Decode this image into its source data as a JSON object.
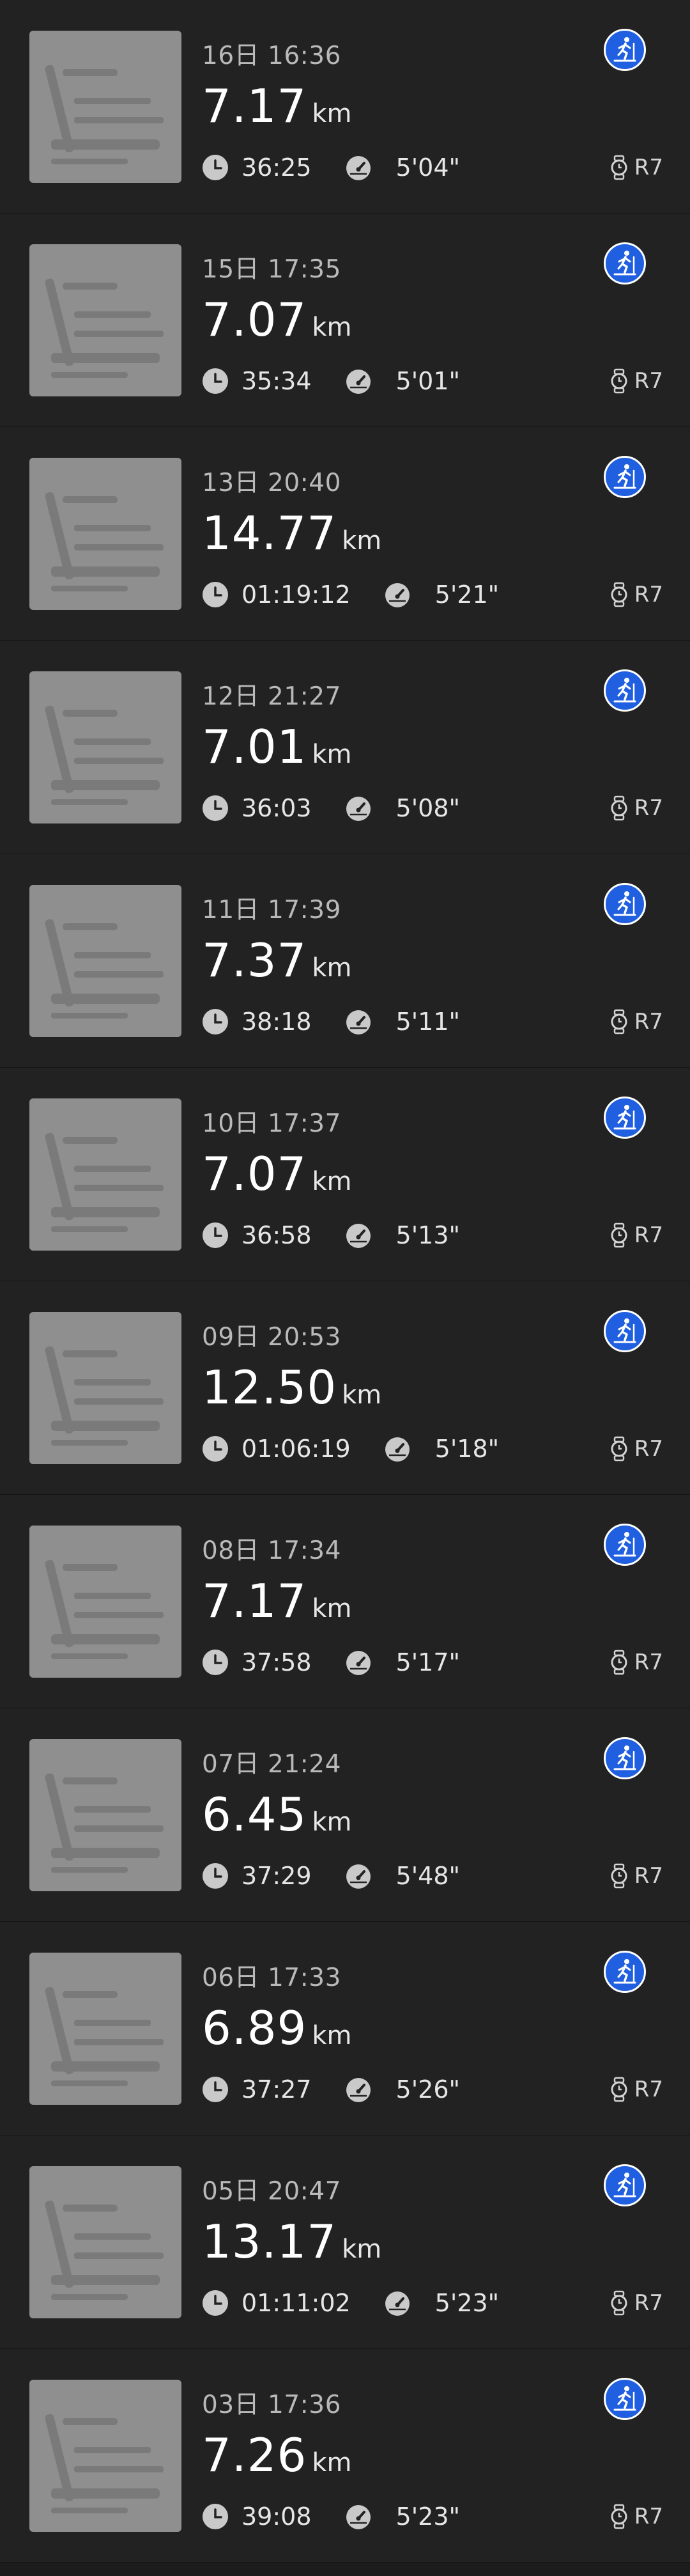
{
  "runs": [
    {
      "date": "16日 16:36",
      "distance": "7.17",
      "unit": "km",
      "duration": "36:25",
      "pace": "5'04\"",
      "device": "R7"
    },
    {
      "date": "15日 17:35",
      "distance": "7.07",
      "unit": "km",
      "duration": "35:34",
      "pace": "5'01\"",
      "device": "R7"
    },
    {
      "date": "13日 20:40",
      "distance": "14.77",
      "unit": "km",
      "duration": "01:19:12",
      "pace": "5'21\"",
      "device": "R7"
    },
    {
      "date": "12日 21:27",
      "distance": "7.01",
      "unit": "km",
      "duration": "36:03",
      "pace": "5'08\"",
      "device": "R7"
    },
    {
      "date": "11日 17:39",
      "distance": "7.37",
      "unit": "km",
      "duration": "38:18",
      "pace": "5'11\"",
      "device": "R7"
    },
    {
      "date": "10日 17:37",
      "distance": "7.07",
      "unit": "km",
      "duration": "36:58",
      "pace": "5'13\"",
      "device": "R7"
    },
    {
      "date": "09日 20:53",
      "distance": "12.50",
      "unit": "km",
      "duration": "01:06:19",
      "pace": "5'18\"",
      "device": "R7"
    },
    {
      "date": "08日 17:34",
      "distance": "7.17",
      "unit": "km",
      "duration": "37:58",
      "pace": "5'17\"",
      "device": "R7"
    },
    {
      "date": "07日 21:24",
      "distance": "6.45",
      "unit": "km",
      "duration": "37:29",
      "pace": "5'48\"",
      "device": "R7"
    },
    {
      "date": "06日 17:33",
      "distance": "6.89",
      "unit": "km",
      "duration": "37:27",
      "pace": "5'26\"",
      "device": "R7"
    },
    {
      "date": "05日 20:47",
      "distance": "13.17",
      "unit": "km",
      "duration": "01:11:02",
      "pace": "5'23\"",
      "device": "R7"
    },
    {
      "date": "03日 17:36",
      "distance": "7.26",
      "unit": "km",
      "duration": "39:08",
      "pace": "5'23\"",
      "device": "R7"
    }
  ],
  "icons": {
    "sport": "treadmill-running-icon",
    "duration": "clock-icon",
    "pace": "speedometer-icon",
    "device": "watch-icon",
    "thumbnail": "treadmill-image"
  },
  "colors": {
    "background": "#1c1c1c",
    "card": "#222222",
    "accent": "#1f5fe0"
  }
}
